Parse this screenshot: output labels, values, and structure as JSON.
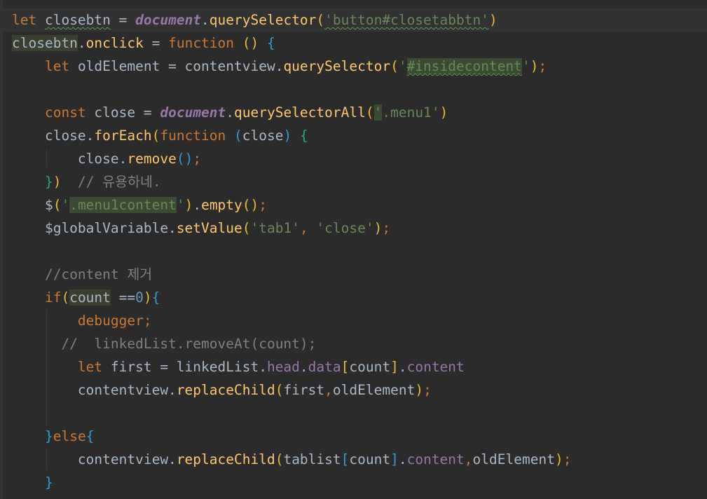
{
  "editor": {
    "theme_colors": {
      "background": "#2b2b2b",
      "keyword": "#cc7832",
      "string": "#6a8759",
      "function": "#ffc66d",
      "property": "#9876aa",
      "comment": "#808080",
      "text": "#a9b7c6"
    },
    "lines": [
      [
        [
          "kw",
          "let "
        ],
        [
          "plain",
          "closebtn"
        ],
        [
          "plain",
          " = "
        ],
        [
          "doc",
          "document"
        ],
        [
          "plain",
          "."
        ],
        [
          "fn",
          "querySelector"
        ],
        [
          "p1",
          "("
        ],
        [
          "str",
          "'button#closetabbtn'"
        ],
        [
          "p1",
          ")"
        ]
      ],
      [
        [
          "plain",
          "closebtn"
        ],
        [
          "plain",
          "."
        ],
        [
          "fn",
          "onclick"
        ],
        [
          "plain",
          " = "
        ],
        [
          "kw",
          "function "
        ],
        [
          "p1",
          "()"
        ],
        [
          "plain",
          " "
        ],
        [
          "p2",
          "{"
        ]
      ],
      [
        [
          "plain",
          "    "
        ],
        [
          "kw",
          "let "
        ],
        [
          "plain",
          "oldElement = contentview."
        ],
        [
          "fn",
          "querySelector"
        ],
        [
          "p1",
          "("
        ],
        [
          "str",
          "'"
        ],
        [
          "str",
          "#insidecontent"
        ],
        [
          "str",
          "'"
        ],
        [
          "p1",
          ")"
        ],
        [
          "kw",
          ";"
        ]
      ],
      [],
      [
        [
          "plain",
          "    "
        ],
        [
          "kw",
          "const "
        ],
        [
          "plain",
          "close = "
        ],
        [
          "doc",
          "document"
        ],
        [
          "plain",
          "."
        ],
        [
          "fn",
          "querySelectorAll"
        ],
        [
          "p1",
          "("
        ],
        [
          "str",
          "'"
        ],
        [
          "str",
          ".menu1"
        ],
        [
          "str",
          "'"
        ],
        [
          "p1",
          ")"
        ]
      ],
      [
        [
          "plain",
          "    close."
        ],
        [
          "fn",
          "forEach"
        ],
        [
          "p1",
          "("
        ],
        [
          "kw",
          "function "
        ],
        [
          "p2",
          "("
        ],
        [
          "plain",
          "close"
        ],
        [
          "p2",
          ")"
        ],
        [
          "plain",
          " "
        ],
        [
          "p3",
          "{"
        ]
      ],
      [
        [
          "plain",
          "        close."
        ],
        [
          "fn",
          "remove"
        ],
        [
          "p2",
          "()"
        ],
        [
          "kw",
          ";"
        ]
      ],
      [
        [
          "plain",
          "    "
        ],
        [
          "p3",
          "}"
        ],
        [
          "p1",
          ")"
        ],
        [
          "plain",
          "  "
        ],
        [
          "cm",
          "// 유용하네."
        ]
      ],
      [
        [
          "plain",
          "    $"
        ],
        [
          "p1",
          "("
        ],
        [
          "str",
          "'"
        ],
        [
          "str",
          ".menu1content"
        ],
        [
          "str",
          "'"
        ],
        [
          "p1",
          ")"
        ],
        [
          "plain",
          "."
        ],
        [
          "fn",
          "empty"
        ],
        [
          "p1",
          "()"
        ],
        [
          "kw",
          ";"
        ]
      ],
      [
        [
          "plain",
          "    $globalVariable."
        ],
        [
          "fn",
          "setValue"
        ],
        [
          "p1",
          "("
        ],
        [
          "str",
          "'tab1'"
        ],
        [
          "kw",
          ", "
        ],
        [
          "str",
          "'close'"
        ],
        [
          "p1",
          ")"
        ],
        [
          "kw",
          ";"
        ]
      ],
      [],
      [
        [
          "plain",
          "    "
        ],
        [
          "cm",
          "//content 제거"
        ]
      ],
      [
        [
          "plain",
          "    "
        ],
        [
          "kw",
          "if"
        ],
        [
          "p1",
          "("
        ],
        [
          "plain",
          "count"
        ],
        [
          "plain",
          " =="
        ],
        [
          "num",
          "0"
        ],
        [
          "p1",
          ")"
        ],
        [
          "p2",
          "{"
        ]
      ],
      [
        [
          "plain",
          "        "
        ],
        [
          "kw",
          "debugger;"
        ]
      ],
      [
        [
          "plain",
          "      "
        ],
        [
          "cm",
          "//  linkedList.removeAt(count);"
        ]
      ],
      [
        [
          "plain",
          "        "
        ],
        [
          "kw",
          "let "
        ],
        [
          "plain",
          "first = linkedList."
        ],
        [
          "prop",
          "head"
        ],
        [
          "plain",
          "."
        ],
        [
          "prop",
          "data"
        ],
        [
          "p1",
          "["
        ],
        [
          "plain",
          "count"
        ],
        [
          "p1",
          "]"
        ],
        [
          "plain",
          "."
        ],
        [
          "prop",
          "content"
        ]
      ],
      [
        [
          "plain",
          "        contentview."
        ],
        [
          "fn",
          "replaceChild"
        ],
        [
          "p1",
          "("
        ],
        [
          "plain",
          "first"
        ],
        [
          "kw",
          ","
        ],
        [
          "plain",
          "oldElement"
        ],
        [
          "p1",
          ")"
        ],
        [
          "kw",
          ";"
        ]
      ],
      [],
      [
        [
          "plain",
          "    "
        ],
        [
          "p2",
          "}"
        ],
        [
          "kw",
          "else"
        ],
        [
          "p2",
          "{"
        ]
      ],
      [
        [
          "plain",
          "        contentview."
        ],
        [
          "fn",
          "replaceChild"
        ],
        [
          "p1",
          "("
        ],
        [
          "plain",
          "tablist"
        ],
        [
          "p2",
          "["
        ],
        [
          "plain",
          "count"
        ],
        [
          "p2",
          "]"
        ],
        [
          "plain",
          "."
        ],
        [
          "prop",
          "content"
        ],
        [
          "kw",
          ","
        ],
        [
          "plain",
          "oldElement"
        ],
        [
          "p1",
          ")"
        ],
        [
          "kw",
          ";"
        ]
      ],
      [
        [
          "plain",
          "    "
        ],
        [
          "p2",
          "}"
        ]
      ]
    ]
  }
}
